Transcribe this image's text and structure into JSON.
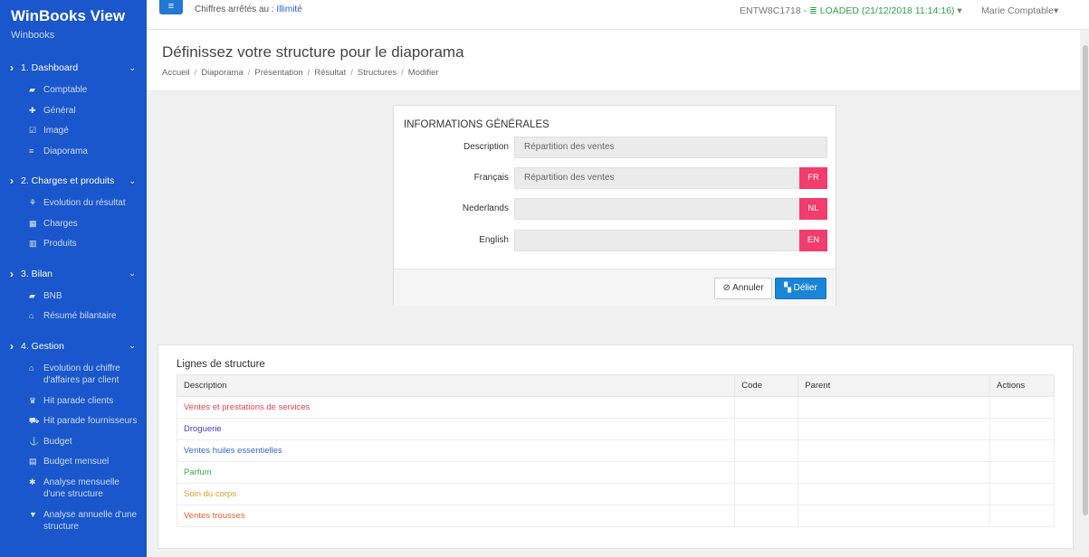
{
  "app": {
    "title": "WinBooks View",
    "subtitle": "Winbooks"
  },
  "sidebar": {
    "sections": [
      {
        "label": "1. Dashboard",
        "items": [
          {
            "icon": "book-icon",
            "glyph": "▰",
            "label": "Comptable"
          },
          {
            "icon": "plus-icon",
            "glyph": "✚",
            "label": "Général"
          },
          {
            "icon": "check-square-icon",
            "glyph": "☑",
            "label": "Imagé"
          },
          {
            "icon": "list-icon",
            "glyph": "≡",
            "label": "Diaporama"
          }
        ]
      },
      {
        "label": "2. Charges et produits",
        "items": [
          {
            "icon": "chart-icon",
            "glyph": "⚘",
            "label": "Evolution du résultat"
          },
          {
            "icon": "table-icon",
            "glyph": "▦",
            "label": "Charges"
          },
          {
            "icon": "bar-chart-icon",
            "glyph": "▥",
            "label": "Produits"
          }
        ]
      },
      {
        "label": "3. Bilan",
        "items": [
          {
            "icon": "book-icon",
            "glyph": "▰",
            "label": "BNB"
          },
          {
            "icon": "bank-icon",
            "glyph": "⌂",
            "label": "Résumé bilantaire"
          }
        ]
      },
      {
        "label": "4. Gestion",
        "items": [
          {
            "icon": "bank-icon",
            "glyph": "⌂",
            "label": "Evolution du chiffre",
            "label2": "d'affaires par client"
          },
          {
            "icon": "trophy-icon",
            "glyph": "♛",
            "label": "Hit parade clients"
          },
          {
            "icon": "truck-icon",
            "glyph": "⛟",
            "label": "Hit parade fournisseurs"
          },
          {
            "icon": "anchor-icon",
            "glyph": "⚓",
            "label": "Budget"
          },
          {
            "icon": "calendar-icon",
            "glyph": "▤",
            "label": "Budget mensuel"
          },
          {
            "icon": "star-icon",
            "glyph": "✱",
            "label": "Analyse mensuelle",
            "label2": "d'une structure"
          },
          {
            "icon": "glass-icon",
            "glyph": "▼",
            "label": "Analyse annuelle d'une",
            "label2": "structure"
          }
        ]
      }
    ]
  },
  "topbar": {
    "chiffres_label": "Chiffres arrêtés au : ",
    "chiffres_value": "Illimité",
    "connection": "ENTW8C1718 - ",
    "loaded": "LOADED (21/12/2018 11:14:16)",
    "user": "Marie Comptable"
  },
  "page": {
    "title": "Définissez votre structure pour le diaporama",
    "breadcrumb": [
      "Accueil",
      "Diaporama",
      "Présentation",
      "Résultat",
      "Structures",
      "Modifier"
    ]
  },
  "info_card": {
    "title": "INFORMATIONS GÉNÉRALES",
    "fields": [
      {
        "label": "Description",
        "value": "Répartition des ventes",
        "badge": ""
      },
      {
        "label": "Français",
        "value": "Répartition des ventes",
        "badge": "FR"
      },
      {
        "label": "Nederlands",
        "value": "",
        "badge": "NL"
      },
      {
        "label": "English",
        "value": "",
        "badge": "EN"
      }
    ],
    "cancel_label": "Annuler",
    "unlink_label": "Délier"
  },
  "structure": {
    "title": "Lignes de structure",
    "columns": [
      "Description",
      "Code",
      "Parent",
      "Actions"
    ],
    "rows": [
      {
        "description": "Ventes et prestations de services",
        "color": "#e8414f"
      },
      {
        "description": "Droguerie",
        "color": "#4a3ad0"
      },
      {
        "description": "Ventes huiles essentielles",
        "color": "#3a63c8"
      },
      {
        "description": "Parfum",
        "color": "#3aa655"
      },
      {
        "description": "Soin du corps",
        "color": "#d1a12a"
      },
      {
        "description": "Ventes trousses",
        "color": "#e0622c"
      }
    ]
  }
}
